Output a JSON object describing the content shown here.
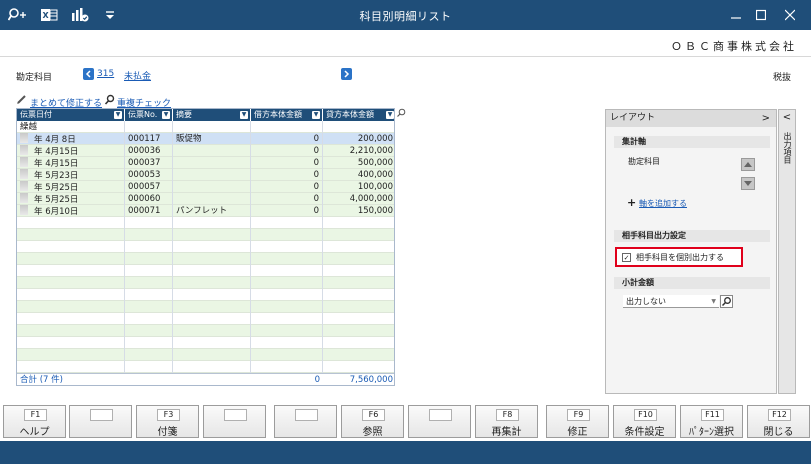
{
  "window": {
    "title": "科目別明細リスト",
    "company": "ＯＢＣ商事株式会社"
  },
  "account": {
    "label": "勘定科目",
    "code": "315",
    "name": "未払金",
    "tax_label": "税抜"
  },
  "tools": {
    "bulk_edit": "まとめて修正する",
    "dup_check": "重複チェック"
  },
  "grid": {
    "headers": [
      "伝票日付",
      "伝票No.",
      "摘要",
      "借方本体金額",
      "貸方本体金額"
    ],
    "carry_label": "繰越",
    "rows": [
      {
        "date": "年 4月 8日",
        "no": "000117",
        "memo": "販促物",
        "debit": "0",
        "credit": "200,000"
      },
      {
        "date": "年 4月15日",
        "no": "000036",
        "memo": "",
        "debit": "0",
        "credit": "2,210,000"
      },
      {
        "date": "年 4月15日",
        "no": "000037",
        "memo": "",
        "debit": "0",
        "credit": "500,000"
      },
      {
        "date": "年 5月23日",
        "no": "000053",
        "memo": "",
        "debit": "0",
        "credit": "400,000"
      },
      {
        "date": "年 5月25日",
        "no": "000057",
        "memo": "",
        "debit": "0",
        "credit": "100,000"
      },
      {
        "date": "年 5月25日",
        "no": "000060",
        "memo": "",
        "debit": "0",
        "credit": "4,000,000"
      },
      {
        "date": "年 6月10日",
        "no": "000071",
        "memo": "パンフレット",
        "debit": "0",
        "credit": "150,000"
      }
    ],
    "total": {
      "label": "合計 (7 件)",
      "debit": "0",
      "credit": "7,560,000"
    }
  },
  "panel": {
    "title": "レイアウト",
    "collapse_glyph": ">",
    "agg_axis_title": "集計軸",
    "agg_axis_item": "勘定科目",
    "add_axis": "軸を追加する",
    "counter_title": "相手科目出力設定",
    "counter_check_label": "相手科目を個別出力する",
    "counter_checked": true,
    "subtotal_title": "小計金額",
    "subtotal_value": "出力しない"
  },
  "side_tab": {
    "glyph": "<",
    "label": "出力項目"
  },
  "fkeys": [
    {
      "key": "F1",
      "label": "ヘルプ"
    },
    {
      "key": "",
      "label": ""
    },
    {
      "key": "F3",
      "label": "付箋"
    },
    {
      "key": "",
      "label": ""
    },
    {
      "key": "",
      "label": ""
    },
    {
      "key": "F6",
      "label": "参照"
    },
    {
      "key": "",
      "label": ""
    },
    {
      "key": "F8",
      "label": "再集計"
    },
    {
      "key": "F9",
      "label": "修正"
    },
    {
      "key": "F10",
      "label": "条件設定"
    },
    {
      "key": "F11",
      "label": "ﾊﾟﾀｰﾝ選択"
    },
    {
      "key": "F12",
      "label": "閉じる"
    }
  ],
  "colors": {
    "accent": "#1f4e79",
    "link": "#1a5bb5",
    "highlight": "#e0001b",
    "row_green": "#eaf6e4",
    "row_selected": "#cfe0f5"
  }
}
